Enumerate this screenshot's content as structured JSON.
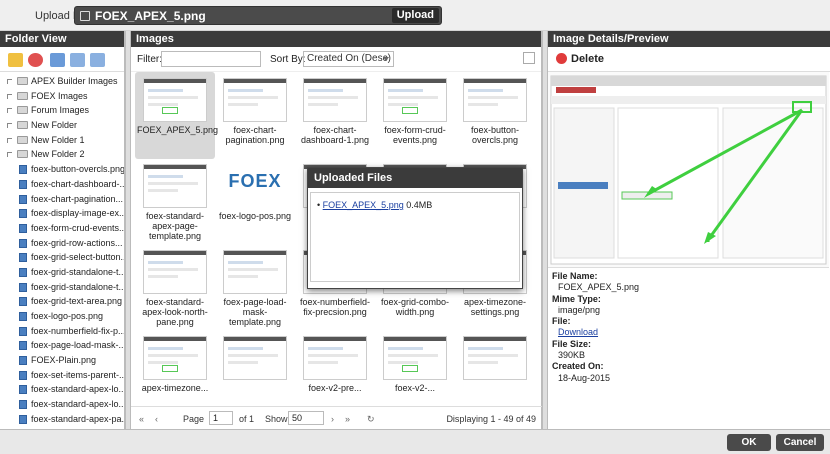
{
  "top": {
    "upload_label": "Upload Files:",
    "file_name": "FOEX_APEX_5.png",
    "upload_button": "Upload"
  },
  "left": {
    "title": "Folder View",
    "tree": [
      {
        "label": "APEX Builder Images",
        "type": "folder"
      },
      {
        "label": "FOEX Images",
        "type": "folder"
      },
      {
        "label": "Forum Images",
        "type": "folder"
      },
      {
        "label": "New Folder",
        "type": "folder"
      },
      {
        "label": "New Folder 1",
        "type": "folder"
      },
      {
        "label": "New Folder 2",
        "type": "folder"
      },
      {
        "label": "foex-button-overcls.png",
        "type": "file"
      },
      {
        "label": "foex-chart-dashboard-...",
        "type": "file"
      },
      {
        "label": "foex-chart-pagination...",
        "type": "file"
      },
      {
        "label": "foex-display-image-ex...",
        "type": "file"
      },
      {
        "label": "foex-form-crud-events...",
        "type": "file"
      },
      {
        "label": "foex-grid-row-actions...",
        "type": "file"
      },
      {
        "label": "foex-grid-select-button...",
        "type": "file"
      },
      {
        "label": "foex-grid-standalone-t...",
        "type": "file"
      },
      {
        "label": "foex-grid-standalone-t...",
        "type": "file"
      },
      {
        "label": "foex-grid-text-area.png",
        "type": "file"
      },
      {
        "label": "foex-logo-pos.png",
        "type": "file"
      },
      {
        "label": "foex-numberfield-fix-p...",
        "type": "file"
      },
      {
        "label": "foex-page-load-mask-...",
        "type": "file"
      },
      {
        "label": "FOEX-Plain.png",
        "type": "file"
      },
      {
        "label": "foex-set-items-parent-...",
        "type": "file"
      },
      {
        "label": "foex-standard-apex-lo...",
        "type": "file"
      },
      {
        "label": "foex-standard-apex-lo...",
        "type": "file"
      },
      {
        "label": "foex-standard-apex-pa...",
        "type": "file"
      }
    ]
  },
  "mid": {
    "title": "Images",
    "filter_label": "Filter:",
    "sort_label": "Sort By:",
    "sort_value": "Created On (Desc)",
    "thumbs": [
      {
        "cap": "FOEX_APEX_5.png",
        "selected": true
      },
      {
        "cap": "foex-chart-pagination.png"
      },
      {
        "cap": "foex-chart-dashboard-1.png"
      },
      {
        "cap": "foex-form-crud-events.png"
      },
      {
        "cap": "foex-button-overcls.png"
      },
      {
        "cap": "foex-standard-apex-page-template.png"
      },
      {
        "cap": "foex-logo-pos.png",
        "logo": "FOEX"
      },
      {
        "cap": ""
      },
      {
        "cap": ""
      },
      {
        "cap": ""
      },
      {
        "cap": "foex-standard-apex-look-north-pane.png"
      },
      {
        "cap": "foex-page-load-mask-template.png"
      },
      {
        "cap": "foex-numberfield-fix-precsion.png"
      },
      {
        "cap": "foex-grid-combo-width.png"
      },
      {
        "cap": "apex-timezone-settings.png"
      },
      {
        "cap": "apex-timezone..."
      },
      {
        "cap": ""
      },
      {
        "cap": "foex-v2-pre..."
      },
      {
        "cap": "foex-v2-..."
      },
      {
        "cap": ""
      }
    ],
    "pager": {
      "page_label": "Page",
      "page_value": "1",
      "of_label": "of 1",
      "show_label": "Show",
      "show_value": "50",
      "display_text": "Displaying 1 - 49 of 49"
    }
  },
  "dialog": {
    "title": "Uploaded Files",
    "file_link": "FOEX_APEX_5.png",
    "file_size": "0.4MB"
  },
  "right": {
    "title": "Image Details/Preview",
    "delete_label": "Delete",
    "details": [
      {
        "k": "File Name:",
        "v": "FOEX_APEX_5.png"
      },
      {
        "k": "Mime Type:",
        "v": "image/png"
      },
      {
        "k": "File:",
        "v": "Download",
        "link": true
      },
      {
        "k": "File Size:",
        "v": "390KB"
      },
      {
        "k": "Created On:",
        "v": "18-Aug-2015"
      }
    ]
  },
  "footer": {
    "ok": "OK",
    "cancel": "Cancel"
  },
  "colors": {
    "header_bg": "#3b3b3b",
    "accent_green": "#3fcf3f",
    "link": "#1a3fa0",
    "delete_red": "#e03b3b"
  }
}
